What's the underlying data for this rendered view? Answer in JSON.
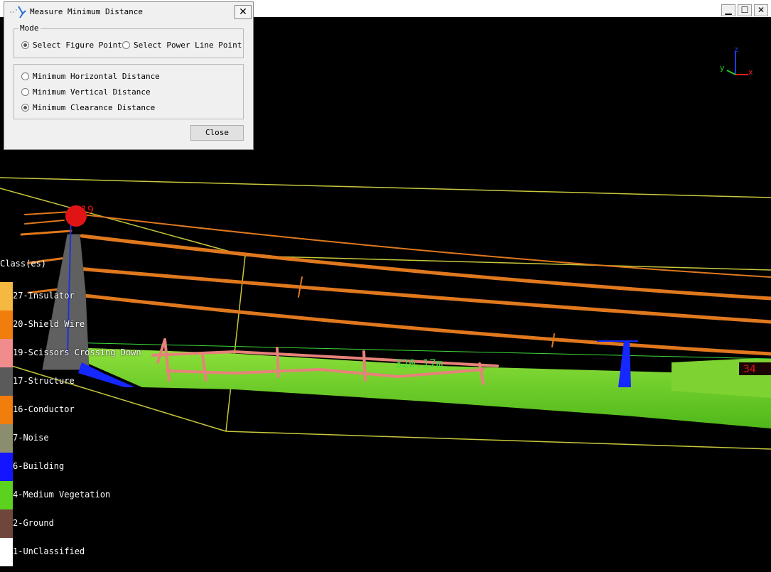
{
  "dialog": {
    "title": "Measure Minimum Distance",
    "close_glyph": "✕",
    "mode_group_label": "Mode",
    "mode_options": [
      {
        "label": "Select Figure Point",
        "selected": true
      },
      {
        "label": "Select Power Line Point",
        "selected": false
      }
    ],
    "distance_options": [
      {
        "label": "Minimum Horizontal Distance",
        "selected": false
      },
      {
        "label": "Minimum Vertical Distance",
        "selected": false
      },
      {
        "label": "Minimum Clearance Distance",
        "selected": true
      }
    ],
    "close_button_label": "Close"
  },
  "window_controls": {
    "minimize": "▁",
    "maximize": "☐",
    "close": "✕"
  },
  "viewport": {
    "tower_marker_label": "19",
    "distance_label": "320.17m",
    "right_marker_label": "34",
    "axis_labels": {
      "x": "x",
      "y": "y",
      "z": "z"
    }
  },
  "legend": {
    "title": "Class(es)",
    "classes": [
      {
        "label": "27-Insulator",
        "color": "#f5b942"
      },
      {
        "label": "20-Shield Wire",
        "color": "#f07d0c"
      },
      {
        "label": "19-Scissors Crossing Down",
        "color": "#f08c8c"
      },
      {
        "label": "17-Structure",
        "color": "#5a5a5a"
      },
      {
        "label": "16-Conductor",
        "color": "#f07d0c"
      },
      {
        "label": "7-Noise",
        "color": "#8c8c6e"
      },
      {
        "label": "6-Building",
        "color": "#1414ff"
      },
      {
        "label": "4-Medium Vegetation",
        "color": "#5ad21e"
      },
      {
        "label": "2-Ground",
        "color": "#6e463c"
      },
      {
        "label": "1-UnClassified",
        "color": "#ffffff"
      }
    ]
  }
}
